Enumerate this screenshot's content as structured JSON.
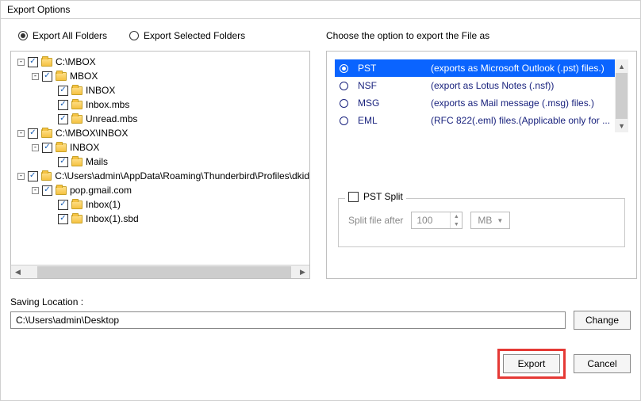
{
  "window": {
    "title": "Export Options"
  },
  "mode": {
    "all": {
      "label": "Export All Folders",
      "selected": true
    },
    "selected": {
      "label": "Export Selected Folders",
      "selected": false
    }
  },
  "tree": [
    {
      "depth": 0,
      "expander": "-",
      "checked": true,
      "label": "C:\\MBOX"
    },
    {
      "depth": 1,
      "expander": "-",
      "checked": true,
      "label": "MBOX"
    },
    {
      "depth": 2,
      "expander": "",
      "checked": true,
      "label": "INBOX"
    },
    {
      "depth": 2,
      "expander": "",
      "checked": true,
      "label": "Inbox.mbs"
    },
    {
      "depth": 2,
      "expander": "",
      "checked": true,
      "label": "Unread.mbs"
    },
    {
      "depth": 0,
      "expander": "-",
      "checked": true,
      "label": "C:\\MBOX\\INBOX"
    },
    {
      "depth": 1,
      "expander": "-",
      "checked": true,
      "label": "INBOX"
    },
    {
      "depth": 2,
      "expander": "",
      "checked": true,
      "label": "Mails"
    },
    {
      "depth": 0,
      "expander": "-",
      "checked": true,
      "label": "C:\\Users\\admin\\AppData\\Roaming\\Thunderbird\\Profiles\\dkid"
    },
    {
      "depth": 1,
      "expander": "-",
      "checked": true,
      "label": "pop.gmail.com"
    },
    {
      "depth": 2,
      "expander": "",
      "checked": true,
      "label": "Inbox(1)"
    },
    {
      "depth": 2,
      "expander": "",
      "checked": true,
      "label": "Inbox(1).sbd"
    }
  ],
  "format": {
    "heading": "Choose the option to export the File as",
    "options": [
      {
        "key": "pst",
        "name": "PST",
        "desc": "(exports as Microsoft Outlook (.pst) files.)",
        "selected": true
      },
      {
        "key": "nsf",
        "name": "NSF",
        "desc": "(export as Lotus Notes (.nsf))",
        "selected": false
      },
      {
        "key": "msg",
        "name": "MSG",
        "desc": "(exports as Mail message (.msg) files.)",
        "selected": false
      },
      {
        "key": "eml",
        "name": "EML",
        "desc": "(RFC 822(.eml) files.(Applicable only for ...",
        "selected": false
      }
    ]
  },
  "pst_split": {
    "legend": "PST Split",
    "checked": false,
    "label": "Split file after",
    "value": "100",
    "unit": "MB"
  },
  "saving": {
    "label": "Saving Location :",
    "path": "C:\\Users\\admin\\Desktop",
    "change": "Change"
  },
  "buttons": {
    "export": "Export",
    "cancel": "Cancel"
  }
}
